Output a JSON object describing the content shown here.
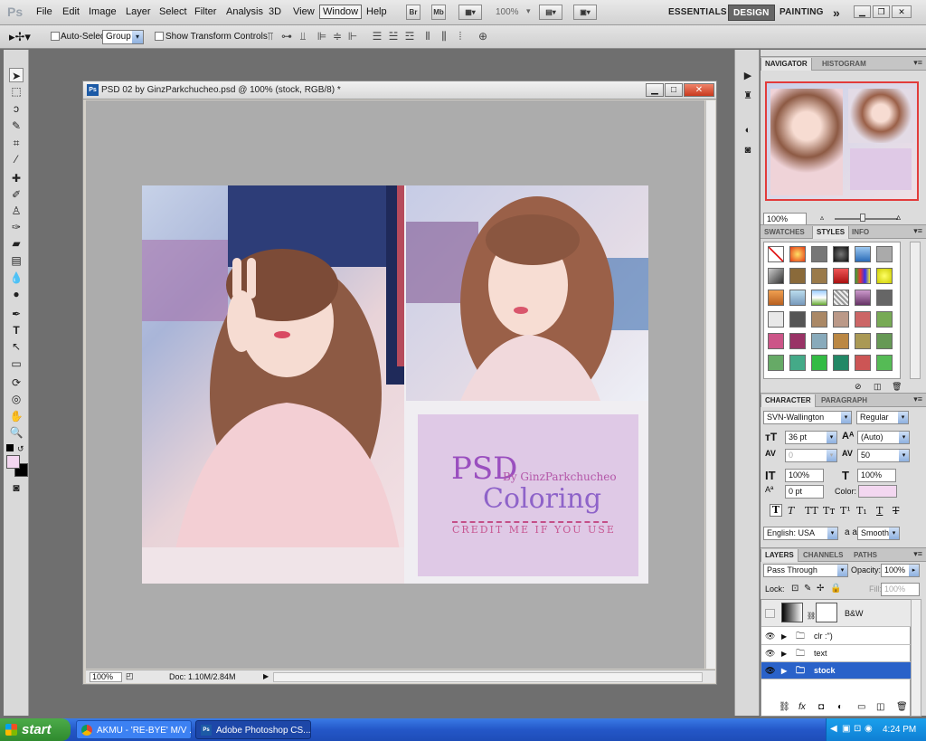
{
  "app": {
    "logo": "Ps"
  },
  "menu": [
    "File",
    "Edit",
    "Image",
    "Layer",
    "Select",
    "Filter",
    "Analysis",
    "3D",
    "View",
    "Window",
    "Help"
  ],
  "menubar_buttons": {
    "bridge": "Br",
    "minibridge": "Mb",
    "zoom": "100%"
  },
  "workspaces": {
    "essentials": "ESSENTIALS",
    "design": "DESIGN",
    "painting": "PAINTING",
    "more": "»"
  },
  "options": {
    "auto_select_label": "Auto-Select:",
    "auto_select_value": "Group",
    "show_transform": "Show Transform Controls"
  },
  "document": {
    "title": "PSD 02 by GinzParkchucheo.psd @ 100% (stock, RGB/8) *",
    "zoom": "100%",
    "doc_size": "Doc: 1.10M/2.84M"
  },
  "artwork": {
    "psd": "PSD",
    "by": "By GinzParkchucheo",
    "coloring": "Coloring",
    "credit": "CREDIT ME IF YOU USE"
  },
  "navigator": {
    "tabs": [
      "NAVIGATOR",
      "HISTOGRAM"
    ],
    "zoom": "100%"
  },
  "styles_panel": {
    "tabs": [
      "SWATCHES",
      "STYLES",
      "INFO"
    ]
  },
  "character": {
    "tabs": [
      "CHARACTER",
      "PARAGRAPH"
    ],
    "font": "SVN-Wallington",
    "style": "Regular",
    "size": "36 pt",
    "leading": "(Auto)",
    "kerning": "0",
    "tracking": "50",
    "vscale": "100%",
    "hscale": "100%",
    "baseline": "0 pt",
    "color_label": "Color:",
    "language": "English: USA",
    "aa_label": "a a",
    "antialias": "Smooth",
    "color": "#f3d7f0"
  },
  "layers": {
    "tabs": [
      "LAYERS",
      "CHANNELS",
      "PATHS"
    ],
    "blend": "Pass Through",
    "opacity_label": "Opacity:",
    "opacity": "100%",
    "lock_label": "Lock:",
    "fill_label": "Fill:",
    "fill": "100%",
    "items": [
      {
        "name": "B&W",
        "selected": false
      },
      {
        "name": "clr :\")",
        "selected": false
      },
      {
        "name": "text",
        "selected": false
      },
      {
        "name": "stock",
        "selected": true
      }
    ]
  },
  "taskbar": {
    "start": "start",
    "items": [
      "AKMU - 'RE-BYE' M/V ...",
      "Adobe Photoshop CS..."
    ],
    "time": "4:24 PM"
  },
  "colors": {
    "accent": "#2a62c9",
    "design_ws": "#666666",
    "credit_box": "#dfc9e6"
  }
}
